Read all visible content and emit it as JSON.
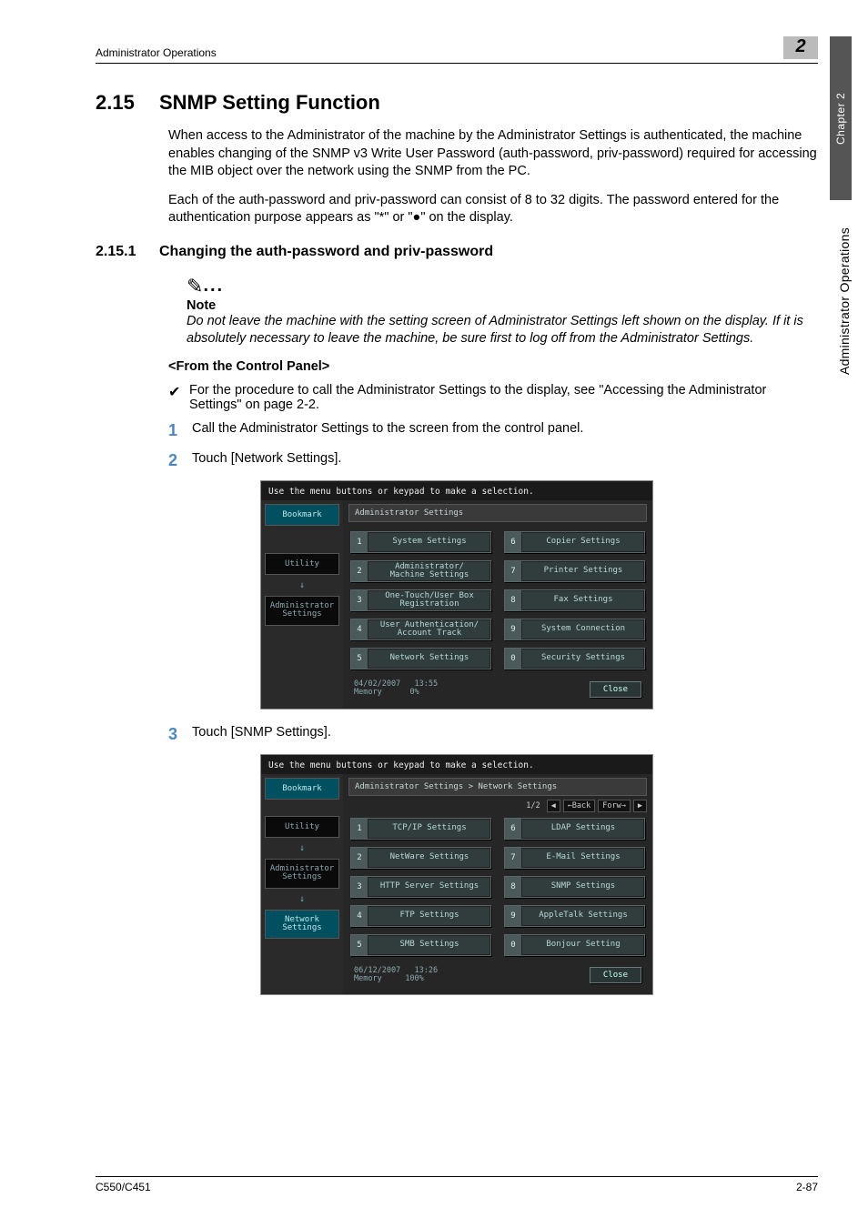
{
  "header": {
    "left": "Administrator Operations",
    "chapnum": "2"
  },
  "side": {
    "chapter": "Chapter 2",
    "ops": "Administrator Operations"
  },
  "section": {
    "num": "2.15",
    "title": "SNMP Setting Function"
  },
  "intro_p1": "When access to the Administrator of the machine by the Administrator Settings is authenticated, the machine enables changing of the SNMP v3 Write User Password (auth-password, priv-password) required for accessing the MIB object over the network using the SNMP from the PC.",
  "intro_p2": "Each of the auth-password and priv-password can consist of 8 to 32 digits. The password entered for the authentication purpose appears as \"*\" or \"●\" on the display.",
  "subsection": {
    "num": "2.15.1",
    "title": "Changing the auth-password and priv-password"
  },
  "note": {
    "label": "Note",
    "text": "Do not leave the machine with the setting screen of Administrator Settings left shown on the display. If it is absolutely necessary to leave the machine, be sure first to log off from the Administrator Settings."
  },
  "from_cp": "<From the Control Panel>",
  "check_text": "For the procedure to call the Administrator Settings to the display, see \"Accessing the Administrator Settings\" on page 2-2.",
  "steps": {
    "s1": "Call the Administrator Settings to the screen from the control panel.",
    "s2": "Touch [Network Settings].",
    "s3": "Touch [SNMP Settings]."
  },
  "panel_common": {
    "topmsg": "Use the menu buttons or keypad to make a selection.",
    "close": "Close",
    "memory_label": "Memory"
  },
  "panel1": {
    "title": "Administrator Settings",
    "side": {
      "bookmark": "Bookmark",
      "utility": "Utility",
      "admin": "Administrator\nSettings"
    },
    "opts": [
      {
        "n": "1",
        "l": "System Settings"
      },
      {
        "n": "2",
        "l": "Administrator/\nMachine Settings"
      },
      {
        "n": "3",
        "l": "One-Touch/User Box\nRegistration"
      },
      {
        "n": "4",
        "l": "User Authentication/\nAccount Track"
      },
      {
        "n": "5",
        "l": "Network Settings"
      },
      {
        "n": "6",
        "l": "Copier Settings"
      },
      {
        "n": "7",
        "l": "Printer Settings"
      },
      {
        "n": "8",
        "l": "Fax Settings"
      },
      {
        "n": "9",
        "l": "System Connection"
      },
      {
        "n": "0",
        "l": "Security Settings"
      }
    ],
    "date": "04/02/2007",
    "time": "13:55",
    "mem": "0%"
  },
  "panel2": {
    "title": "Administrator Settings > Network Settings",
    "paging": {
      "page": "1/2",
      "back": "←Back",
      "fwd": "Forw→"
    },
    "side": {
      "bookmark": "Bookmark",
      "utility": "Utility",
      "admin": "Administrator\nSettings",
      "net": "Network\nSettings"
    },
    "opts": [
      {
        "n": "1",
        "l": "TCP/IP Settings"
      },
      {
        "n": "2",
        "l": "NetWare Settings"
      },
      {
        "n": "3",
        "l": "HTTP Server Settings"
      },
      {
        "n": "4",
        "l": "FTP Settings"
      },
      {
        "n": "5",
        "l": "SMB Settings"
      },
      {
        "n": "6",
        "l": "LDAP Settings"
      },
      {
        "n": "7",
        "l": "E-Mail Settings"
      },
      {
        "n": "8",
        "l": "SNMP Settings"
      },
      {
        "n": "9",
        "l": "AppleTalk Settings"
      },
      {
        "n": "0",
        "l": "Bonjour Setting"
      }
    ],
    "date": "06/12/2007",
    "time": "13:26",
    "mem": "100%"
  },
  "footer": {
    "left": "C550/C451",
    "right": "2-87"
  }
}
